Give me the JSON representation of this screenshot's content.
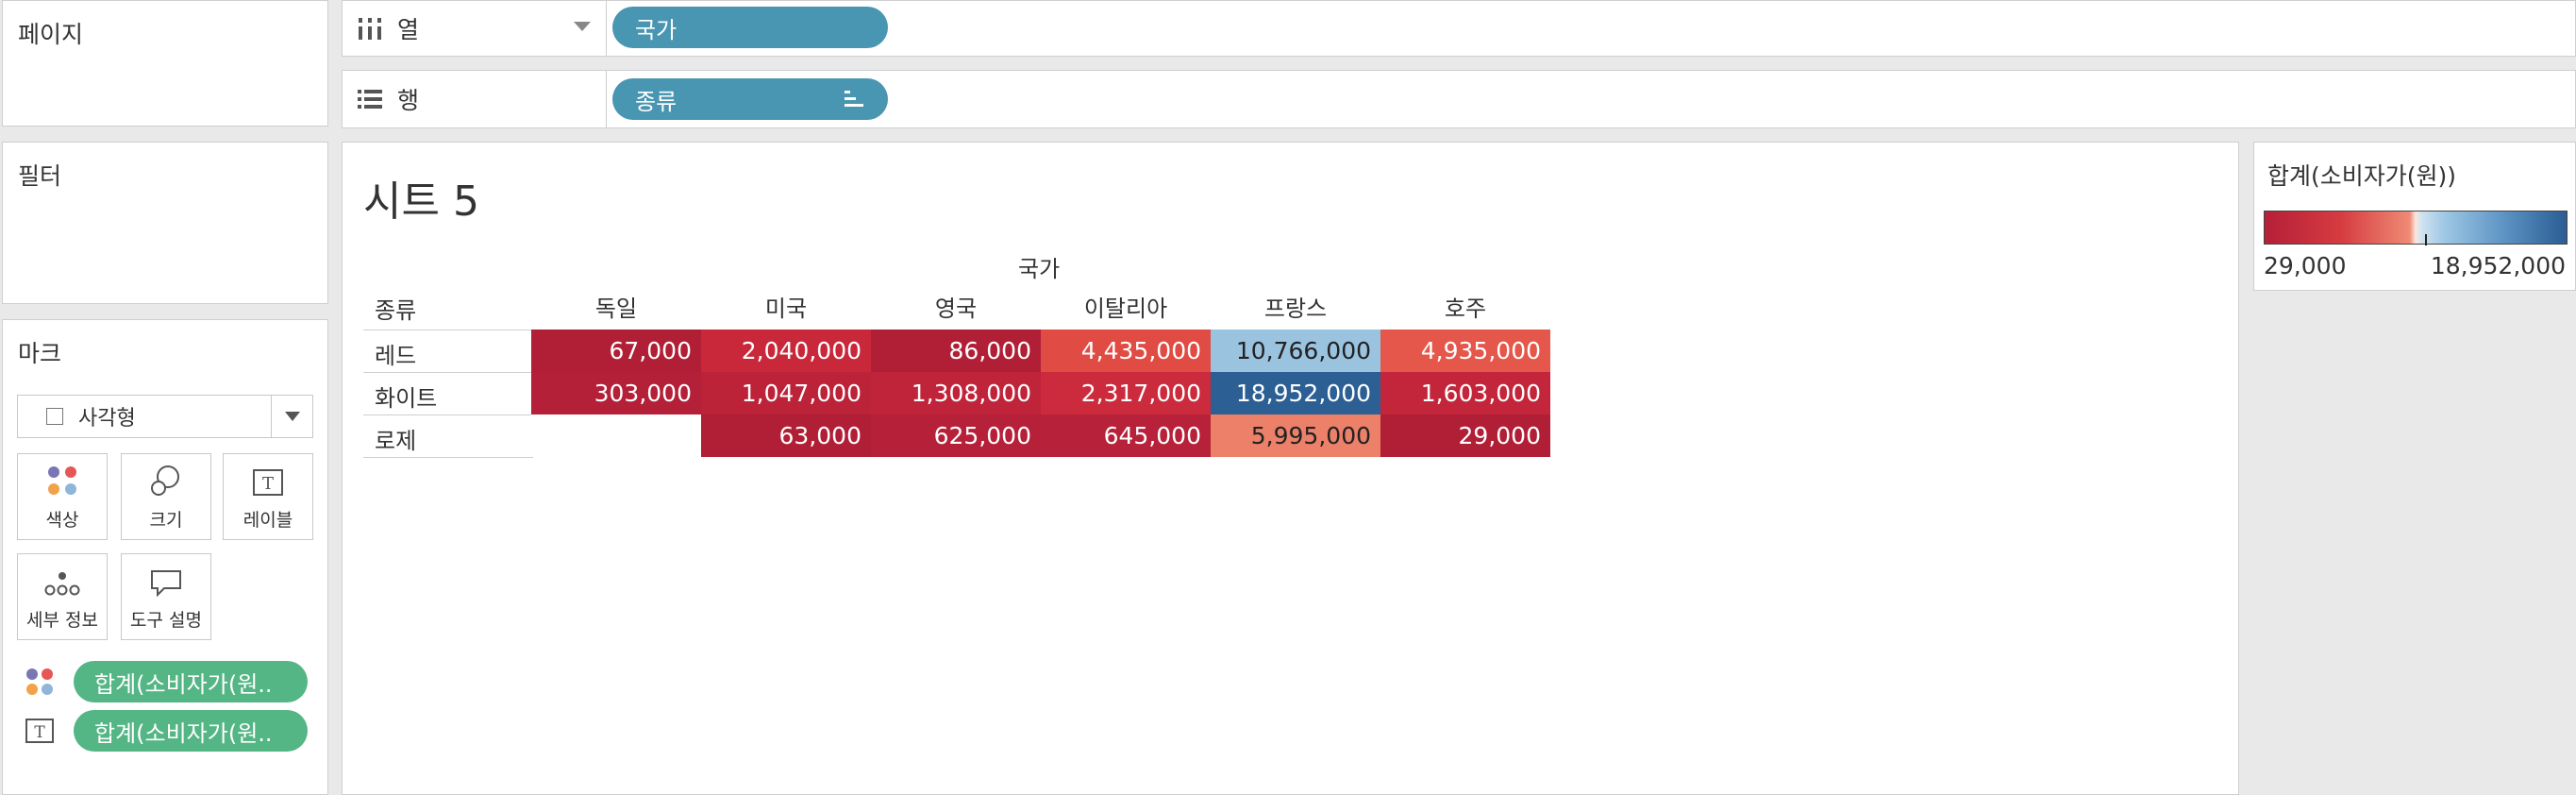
{
  "cards": {
    "pages": "페이지",
    "filters": "필터",
    "marks": "마크",
    "mark_type": "사각형",
    "buttons": {
      "color": "색상",
      "size": "크기",
      "label": "레이블",
      "detail": "세부 정보",
      "tooltip": "도구 설명"
    },
    "mark_pills": [
      "합계(소비자가(원..",
      "합계(소비자가(원.."
    ]
  },
  "shelves": {
    "columns_label": "열",
    "columns_pill": "국가",
    "rows_label": "행",
    "rows_pill": "종류"
  },
  "view": {
    "title": "시트 5",
    "column_field": "국가",
    "row_field": "종류",
    "columns": [
      "독일",
      "미국",
      "영국",
      "이탈리아",
      "프랑스",
      "호주"
    ],
    "rows": [
      {
        "label": "레드",
        "cells": [
          {
            "text": "67,000",
            "color": "#b11f36"
          },
          {
            "text": "2,040,000",
            "color": "#c9283a"
          },
          {
            "text": "86,000",
            "color": "#b11f36"
          },
          {
            "text": "4,435,000",
            "color": "#e04b43"
          },
          {
            "text": "10,766,000",
            "color": "#9ac3e0"
          },
          {
            "text": "4,935,000",
            "color": "#e4574a"
          }
        ]
      },
      {
        "label": "화이트",
        "cells": [
          {
            "text": "303,000",
            "color": "#b32038"
          },
          {
            "text": "1,047,000",
            "color": "#bc2238"
          },
          {
            "text": "1,308,000",
            "color": "#c0243a"
          },
          {
            "text": "2,317,000",
            "color": "#cb2b3c"
          },
          {
            "text": "18,952,000",
            "color": "#2c5f93"
          },
          {
            "text": "1,603,000",
            "color": "#c3263a"
          }
        ]
      },
      {
        "label": "로제",
        "cells": [
          {
            "text": "",
            "color": "#ffffff"
          },
          {
            "text": "63,000",
            "color": "#b11f36"
          },
          {
            "text": "625,000",
            "color": "#b62039"
          },
          {
            "text": "645,000",
            "color": "#b7213a"
          },
          {
            "text": "5,995,000",
            "color": "#ec8069"
          },
          {
            "text": "29,000",
            "color": "#b11f36"
          }
        ]
      }
    ]
  },
  "legend": {
    "title": "합계(소비자가(원))",
    "min": "29,000",
    "max": "18,952,000"
  }
}
